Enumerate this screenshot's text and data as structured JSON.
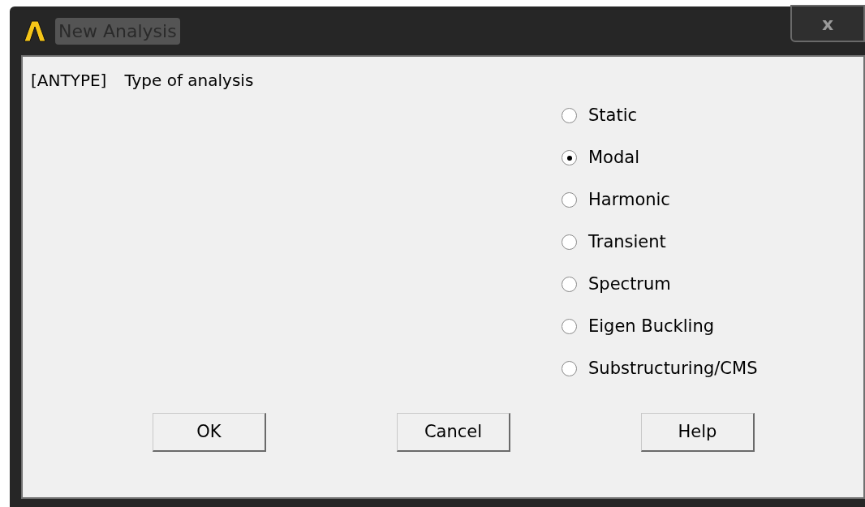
{
  "window": {
    "title": "New Analysis",
    "close": "x"
  },
  "prompt": {
    "code": "[ANTYPE]",
    "label": "Type of analysis"
  },
  "options": [
    {
      "label": "Static",
      "selected": false
    },
    {
      "label": "Modal",
      "selected": true
    },
    {
      "label": "Harmonic",
      "selected": false
    },
    {
      "label": "Transient",
      "selected": false
    },
    {
      "label": "Spectrum",
      "selected": false
    },
    {
      "label": "Eigen Buckling",
      "selected": false
    },
    {
      "label": "Substructuring/CMS",
      "selected": false
    }
  ],
  "buttons": [
    "OK",
    "Cancel",
    "Help"
  ]
}
